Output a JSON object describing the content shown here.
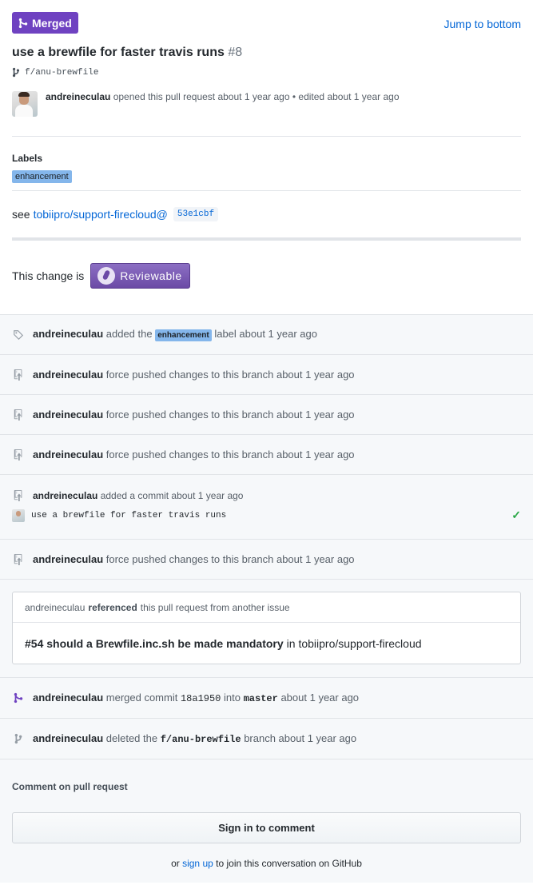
{
  "header": {
    "state": "Merged",
    "jump_label": "Jump to bottom",
    "title": "use a brewfile for faster travis runs",
    "number": "#8",
    "branch": "f/anu-brewfile",
    "author": "andreineculau",
    "opened_text": "opened this pull request about 1 year ago",
    "edited_text": "• edited about 1 year ago"
  },
  "labels": {
    "heading": "Labels",
    "items": [
      "enhancement"
    ]
  },
  "see": {
    "prefix": "see",
    "link": "tobiipro/support-firecloud@",
    "sha": "53e1cbf"
  },
  "reviewable": {
    "text": "This change is",
    "button": "Reviewable"
  },
  "timeline": {
    "label_event": {
      "user": "andreineculau",
      "before": "added the",
      "label": "enhancement",
      "after": "label about 1 year ago"
    },
    "force_push_text": "force pushed changes to this branch about 1 year ago",
    "user": "andreineculau",
    "commit_event": {
      "user": "andreineculau",
      "text": "added a commit about 1 year ago",
      "message": "use a brewfile for faster travis runs",
      "check": "✓"
    },
    "reference": {
      "user": "andreineculau",
      "action": "referenced",
      "rest": "this pull request from another issue",
      "issue": "#54 should a Brewfile.inc.sh be made mandatory",
      "in_text": "in tobiipro/support-firecloud"
    },
    "merged": {
      "user": "andreineculau",
      "text1": "merged commit",
      "sha": "18a1950",
      "text2": "into",
      "branch": "master",
      "text3": "about 1 year ago"
    },
    "deleted": {
      "user": "andreineculau",
      "text1": "deleted the",
      "branch": "f/anu-brewfile",
      "text2": "branch about 1 year ago"
    }
  },
  "comment": {
    "heading": "Comment on pull request",
    "signin": "Sign in to comment",
    "or": "or",
    "signup": "sign up",
    "join_rest": "to join this conversation on GitHub"
  },
  "colors": {
    "merged": "#6f42c1",
    "label": "#84b6eb",
    "link": "#0366d6",
    "check": "#28a745"
  }
}
